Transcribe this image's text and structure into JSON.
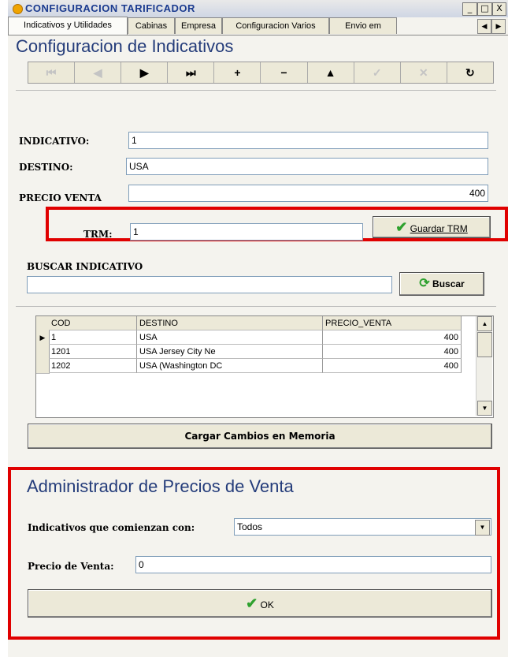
{
  "window": {
    "title": "CONFIGURACION  TARIFICADOR",
    "controls": [
      "_",
      "□",
      "X"
    ]
  },
  "tabs": [
    {
      "label": "Indicativos y Utilidades",
      "active": true
    },
    {
      "label": "Cabinas"
    },
    {
      "label": "Empresa"
    },
    {
      "label": "Configuracion Varios"
    },
    {
      "label": "Envio em"
    }
  ],
  "tab_scroll": [
    "◀",
    "▶"
  ],
  "section1": {
    "title": "Configuracion de Indicativos",
    "nav_buttons": [
      {
        "icon": "first-icon",
        "glyph": "⏮",
        "enabled": false
      },
      {
        "icon": "prior-icon",
        "glyph": "◀",
        "enabled": false
      },
      {
        "icon": "next-icon",
        "glyph": "▶",
        "enabled": true
      },
      {
        "icon": "last-icon",
        "glyph": "⏭",
        "enabled": true
      },
      {
        "icon": "insert-icon",
        "glyph": "+",
        "enabled": true
      },
      {
        "icon": "delete-icon",
        "glyph": "−",
        "enabled": true
      },
      {
        "icon": "edit-icon",
        "glyph": "▲",
        "enabled": true
      },
      {
        "icon": "post-icon",
        "glyph": "✓",
        "enabled": false
      },
      {
        "icon": "cancel-icon",
        "glyph": "✕",
        "enabled": false
      },
      {
        "icon": "refresh-icon",
        "glyph": "↻",
        "enabled": true
      }
    ]
  },
  "fields": {
    "indicativo_label": "INDICATIVO:",
    "indicativo_value": "1",
    "destino_label": "DESTINO:",
    "destino_value": "USA",
    "precio_label": "PRECIO VENTA",
    "precio_value": "400",
    "trm_label": "TRM:",
    "trm_value": "1",
    "guardar_trm": "Guardar TRM"
  },
  "search": {
    "label": "BUSCAR INDICATIVO",
    "value": "",
    "button": "Buscar"
  },
  "grid": {
    "columns": [
      "COD",
      "DESTINO",
      "PRECIO_VENTA"
    ],
    "rows": [
      [
        "1",
        "USA",
        "400"
      ],
      [
        "1201",
        "USA Jersey City Ne",
        "400"
      ],
      [
        "1202",
        "USA (Washington DC",
        "400"
      ]
    ],
    "current_row_marker": "▶"
  },
  "cargar_button": "Cargar Cambios en Memoria",
  "section2": {
    "title": "Administrador de Precios de Venta",
    "prefix_label": "Indicativos que comienzan con:",
    "prefix_value": "Todos",
    "precio_label": "Precio de Venta:",
    "precio_value": "0",
    "ok_button": "OK"
  },
  "colors": {
    "highlight_border": "#e00000",
    "heading": "#243c7a",
    "title_text": "#1b3b8f"
  }
}
